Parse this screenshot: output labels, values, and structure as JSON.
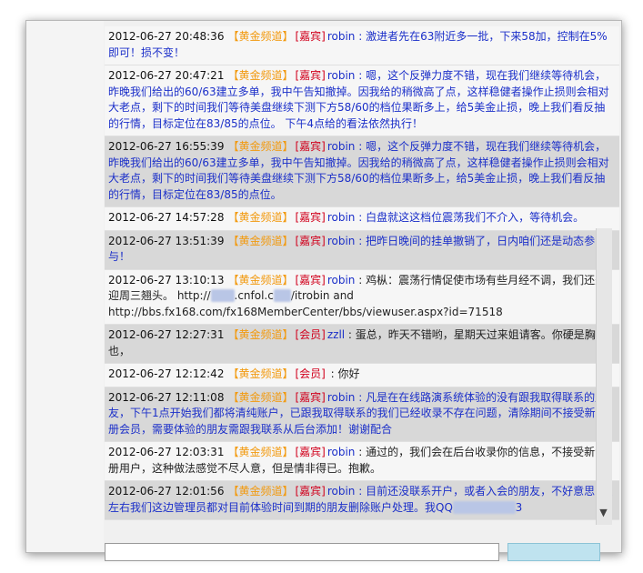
{
  "channel_tag": "【黄金频道】",
  "messages": [
    {
      "ts": "2012-06-27 20:48:36",
      "role": "[嘉宾]",
      "user": "robin",
      "text": " : 激进者先在63附近多一批，下来58加，控制在5%即可！损不变！",
      "color": "blue",
      "shade": "plain"
    },
    {
      "ts": "2012-06-27 20:47:21",
      "role": "[嘉宾]",
      "user": "robin",
      "text": " : 嗯，这个反弹力度不错，现在我们继续等待机会，昨晚我们给出的60/63建立多单，我中午告知撤掉。因我给的稍微高了点，这样稳健者操作止损则会相对大老点，剩下的时间我们等待美盘继续下测下方58/60的档位果断多上，给5美金止损，晚上我们看反抽的行情，目标定位在83/85的点位。 下午4点给的看法依然执行！",
      "color": "blue",
      "shade": "plain"
    },
    {
      "ts": "2012-06-27 16:55:39",
      "role": "[嘉宾]",
      "user": "robin",
      "text": " : 嗯，这个反弹力度不错，现在我们继续等待机会，昨晚我们给出的60/63建立多单，我中午告知撤掉。因我给的稍微高了点，这样稳健者操作止损则会相对大老点，剩下的时间我们等待美盘继续下测下方58/60的档位果断多上，给5美金止损，晚上我们看反抽的行情，目标定位在83/85的点位。",
      "color": "blue",
      "shade": "shaded"
    },
    {
      "ts": "2012-06-27 14:57:28",
      "role": "[嘉宾]",
      "user": "robin",
      "text": " : 白盘就这这档位震荡我们不介入，等待机会。",
      "color": "blue",
      "shade": "plain"
    },
    {
      "ts": "2012-06-27 13:51:39",
      "role": "[嘉宾]",
      "user": "robin",
      "text": " : 把昨日晚间的挂单撤销了，日内咱们还是动态参与！",
      "color": "blue",
      "shade": "shaded"
    },
    {
      "ts": "2012-06-27 13:10:13",
      "role": "[嘉宾]",
      "user": "robin",
      "text": " : 鸡枞：震荡行情促使市场有些月经不调，我们还是迎周三翘头。 http://",
      "text2": "blog",
      "text3": ".cnfol.c",
      "text4": "om",
      "text5": "/itrobin and http://bbs.fx168.com/fx168MemberCenter/bbs/viewuser.aspx?id=71518",
      "color": "dark",
      "shade": "plain"
    },
    {
      "ts": "2012-06-27 12:27:31",
      "role": "[会员]",
      "user": "zzll",
      "text": " : 蛋总，昨天不错哟，星期天过来姐请客。你硬是胸也，",
      "color": "dark",
      "shade": "shaded"
    },
    {
      "ts": "2012-06-27 12:12:42",
      "role": "[会员]",
      "user": "",
      "text": " : 你好",
      "color": "dark",
      "shade": "plain"
    },
    {
      "ts": "2012-06-27 12:11:08",
      "role": "[嘉宾]",
      "user": "robin",
      "text": " : 凡是在在线路演系统体验的没有跟我取得联系的朋友，下午1点开始我们都将清纯账户，已跟我取得联系的我们已经收录不存在问题，清除期间不接受新注册会员，需要体验的朋友需跟我联系从后台添加！谢谢配合",
      "color": "blue",
      "shade": "shaded"
    },
    {
      "ts": "2012-06-27 12:03:31",
      "role": "[嘉宾]",
      "user": "robin",
      "text": " : 通过的，我们会在后台收录你的信息，不接受新注册用户，这种做法感觉不尽人意，但是情非得已。抱歉。",
      "color": "dark",
      "shade": "plain"
    },
    {
      "ts": "2012-06-27 12:01:56",
      "role": "[嘉宾]",
      "user": "robin",
      "text": " : 目前还没联系开户，或者入会的朋友，不好意思1点左右我们这边管理员都对目前体验时间到期的朋友删除账户处理。我QQ",
      "qq_tail": "3",
      "color": "blue",
      "shade": "shaded"
    }
  ],
  "scroll_down_icon": "chevron-down-icon"
}
